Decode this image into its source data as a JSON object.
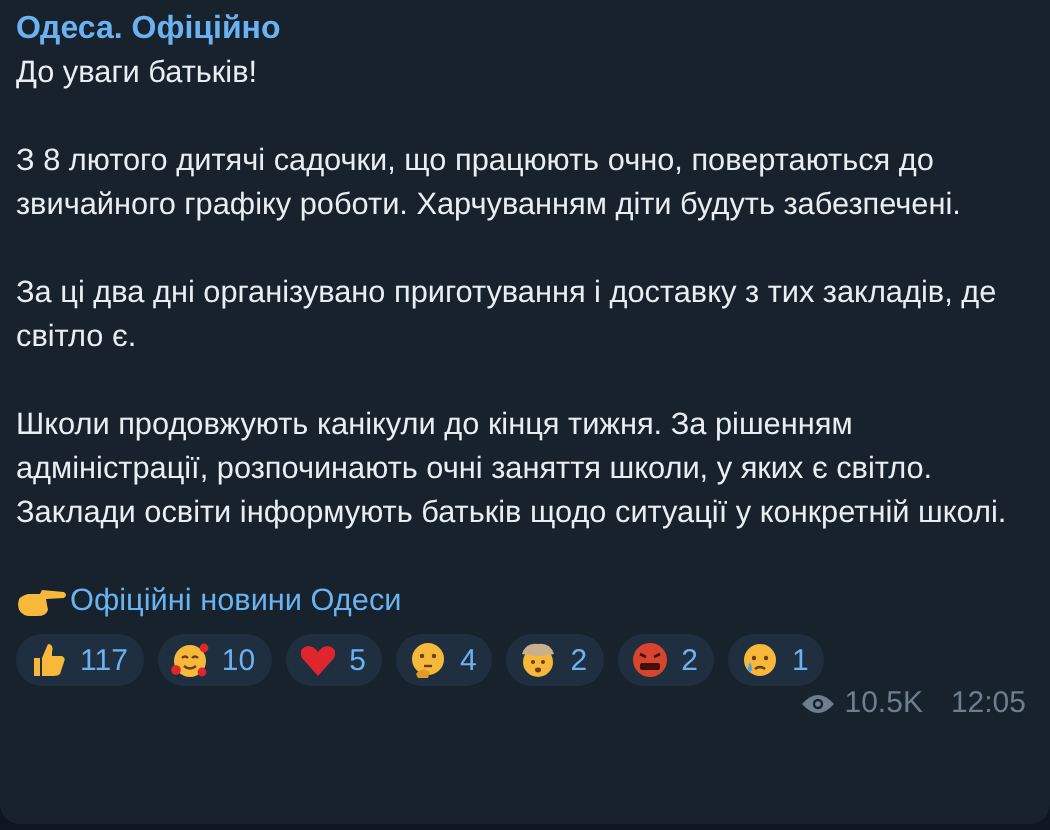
{
  "channel_name": "Одеса. Офіційно",
  "greeting": "До уваги батьків!",
  "paragraphs": [
    "З 8 лютого дитячі садочки, що працюють очно, повертаються до звичайного графіку роботи. Харчуванням діти будуть забезпечені.",
    "За ці два дні організувано приготування і доставку з тих закладів, де світло є.",
    "Школи продовжують канікули до кінця  тижня. За рішенням адміністрації, розпочинають очні заняття школи, у яких є світло. Заклади освіти інформують батьків щодо ситуації у конкретній школі."
  ],
  "link": "Офіційні новини Одеси",
  "reactions": [
    {
      "kind": "thumbs",
      "count": "117"
    },
    {
      "kind": "hearts",
      "count": "10"
    },
    {
      "kind": "heart",
      "count": "5"
    },
    {
      "kind": "thinking",
      "count": "4"
    },
    {
      "kind": "exploding",
      "count": "2"
    },
    {
      "kind": "cursing",
      "count": "2"
    },
    {
      "kind": "crying",
      "count": "1"
    }
  ],
  "views": "10.5K",
  "time": "12:05"
}
